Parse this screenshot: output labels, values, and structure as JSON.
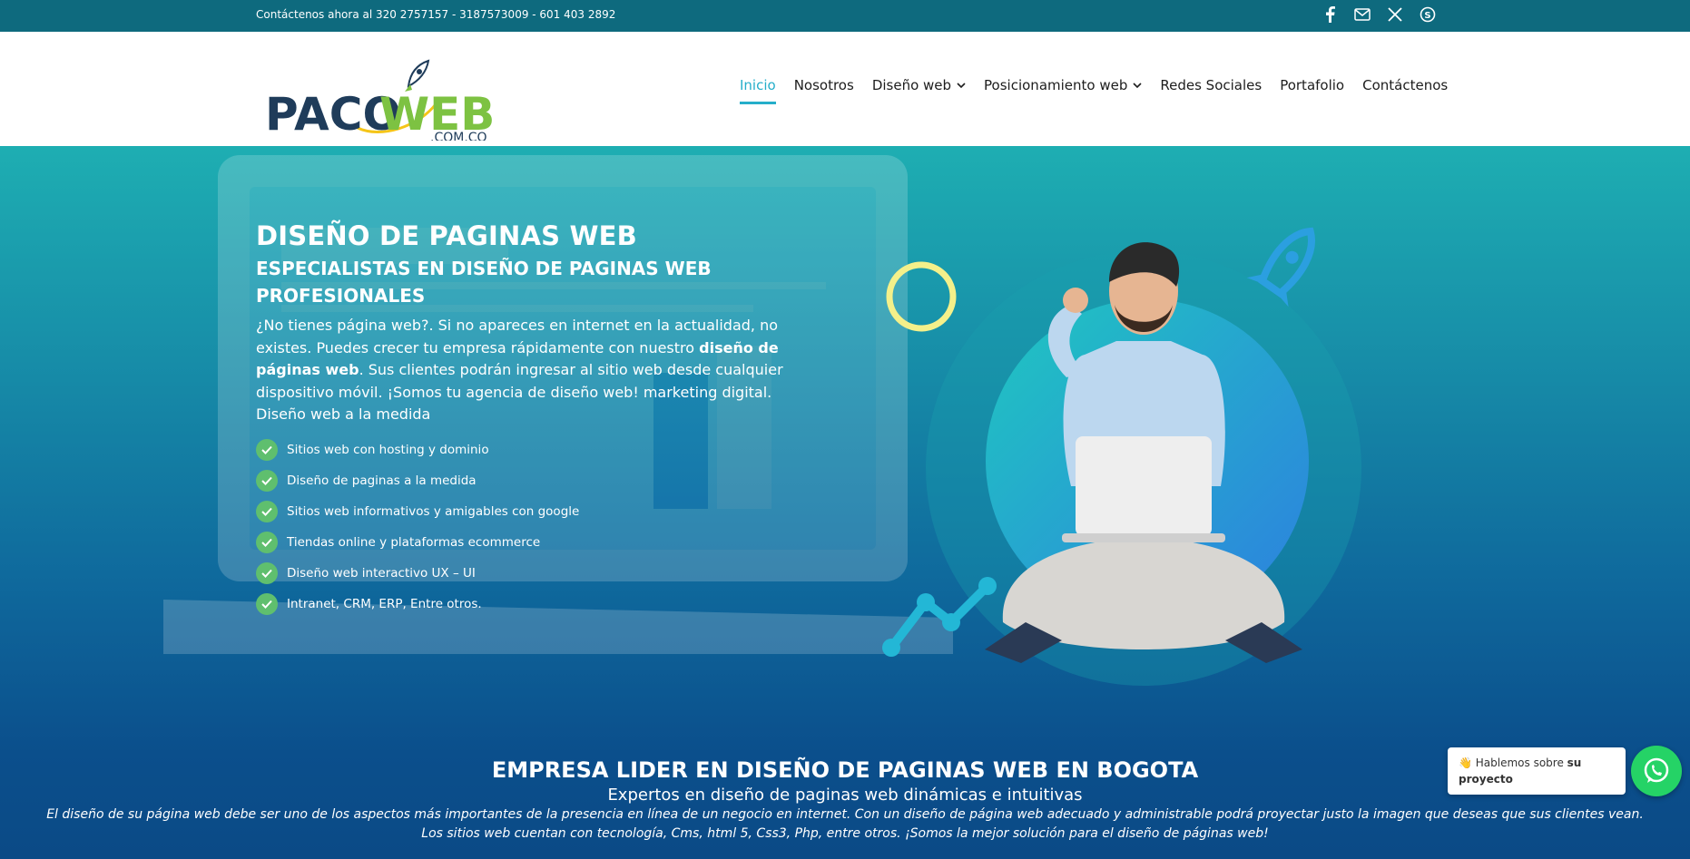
{
  "topbar": {
    "contact": "Contáctenos ahora al 320 2757157 - 3187573009 - 601 403 2892",
    "social_icons": [
      "facebook-icon",
      "email-icon",
      "x-icon",
      "skype-icon"
    ]
  },
  "logo": {
    "brand_part1": "PACO",
    "brand_part2": "WEB",
    "domain": ".COM.CO",
    "colors": {
      "navy": "#1f3c5a",
      "green": "#7dc242",
      "accent": "#f5c518"
    }
  },
  "nav": {
    "items": [
      {
        "label": "Inicio",
        "active": true
      },
      {
        "label": "Nosotros"
      },
      {
        "label": "Diseño web",
        "dropdown": true
      },
      {
        "label": "Posicionamiento web",
        "dropdown": true
      },
      {
        "label": "Redes Sociales"
      },
      {
        "label": "Portafolio"
      },
      {
        "label": "Contáctenos"
      }
    ]
  },
  "hero": {
    "title": "DISEÑO DE PAGINAS WEB",
    "subtitle": "ESPECIALISTAS EN DISEÑO DE PAGINAS WEB PROFESIONALES",
    "para_1": "¿No tienes página web?. Si no apareces en internet en la actualidad, no existes. Puedes crecer tu empresa rápidamente con nuestro ",
    "para_bold": "diseño de páginas web",
    "para_2": ". Sus clientes podrán ingresar al sitio web desde cualquier dispositivo móvil. ¡Somos tu agencia de diseño web! marketing digital.",
    "para_3": "Diseño web a la medida",
    "bullets": [
      "Sitios web con hosting y dominio",
      "Diseño de paginas a la medida",
      "Sitios web informativos y amigables con google",
      "Tiendas online y plataformas ecommerce",
      "Diseño web interactivo UX – UI",
      "Intranet, CRM, ERP, Entre otros."
    ]
  },
  "section": {
    "title": "EMPRESA LIDER EN DISEÑO DE PAGINAS WEB EN BOGOTA",
    "subtitle": "Expertos en diseño de paginas web dinámicas e intuitivas",
    "body": "El diseño de su página web debe ser uno de los aspectos más importantes de la presencia en línea de un negocio en internet. Con un diseño de página web adecuado y administrable podrá proyectar justo la imagen que deseas que sus clientes vean. Los sitios web cuentan con tecnología, Cms, html 5, Css3, Php, entre otros. ¡Somos la mejor solución para el diseño de páginas web!"
  },
  "whatsapp": {
    "text_1": "👋 Hablemos sobre ",
    "text_bold": "su proyecto"
  }
}
